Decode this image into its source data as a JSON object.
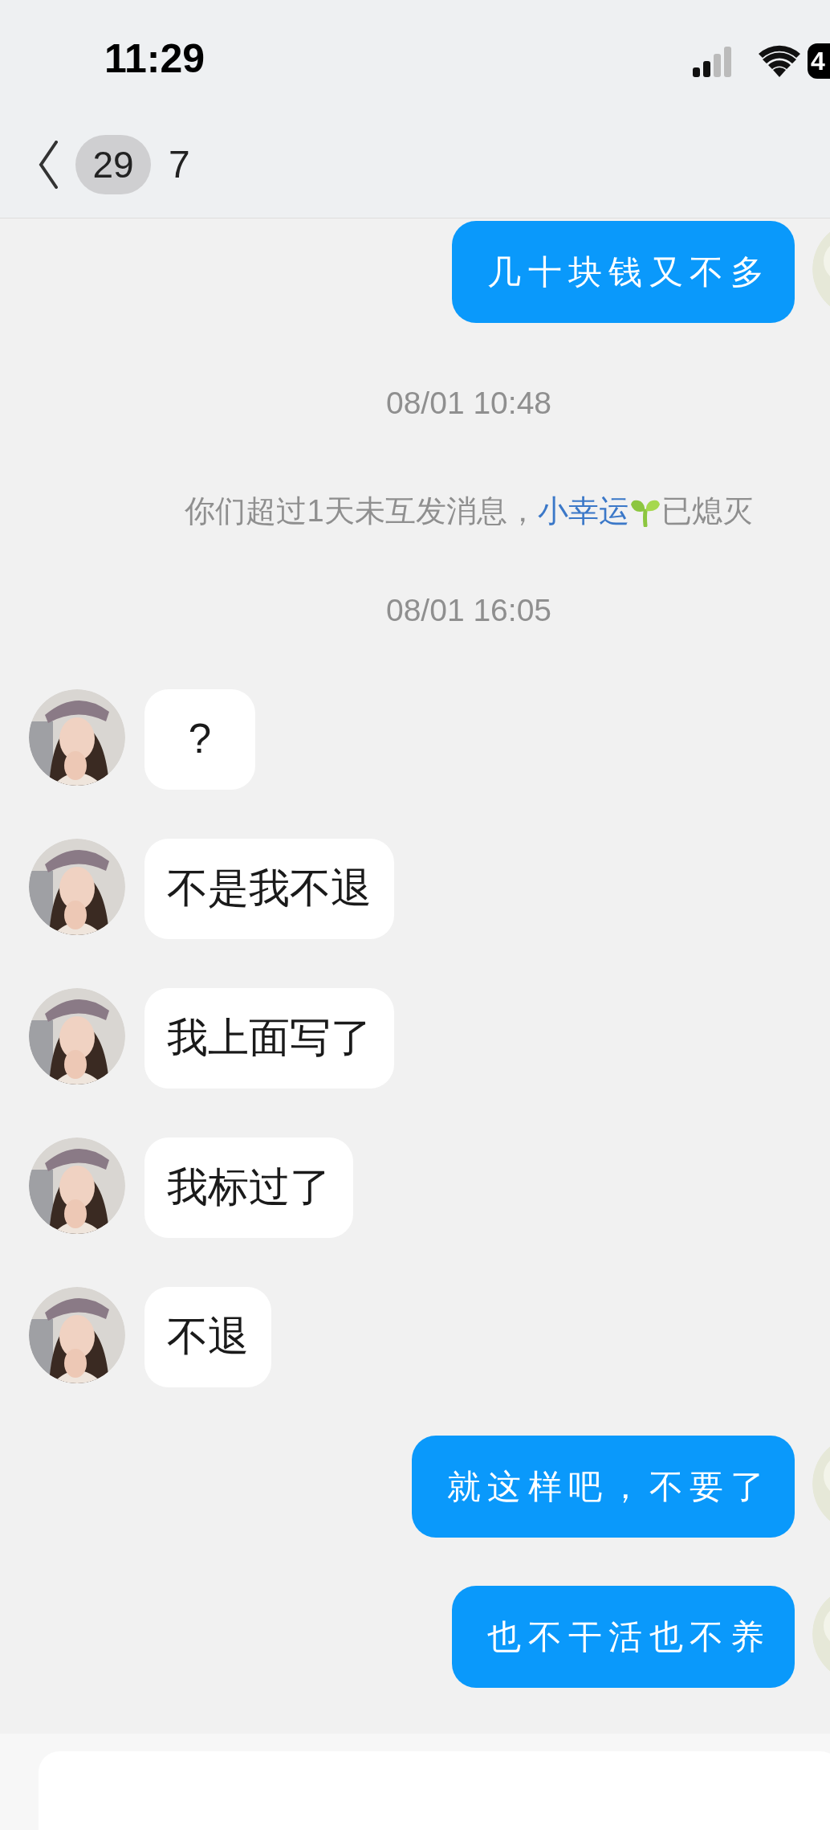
{
  "status_bar": {
    "time": "11:29",
    "battery": "4"
  },
  "header": {
    "unread_count": "29",
    "title": "7"
  },
  "messages": [
    {
      "kind": "sent",
      "text": "几十块钱又不多"
    },
    {
      "kind": "timestamp",
      "text": "08/01 10:48"
    },
    {
      "kind": "system",
      "text_before": "你们超过1天未互发消息，",
      "link": "小幸运",
      "text_after": "已熄灭"
    },
    {
      "kind": "timestamp",
      "text": "08/01 16:05"
    },
    {
      "kind": "received",
      "text": "?"
    },
    {
      "kind": "received",
      "text": "不是我不退"
    },
    {
      "kind": "received",
      "text": "我上面写了"
    },
    {
      "kind": "received",
      "text": "我标过了"
    },
    {
      "kind": "received",
      "text": "不退"
    },
    {
      "kind": "sent",
      "text": "就这样吧，不要了"
    },
    {
      "kind": "sent",
      "text": "也不干活也不养"
    }
  ]
}
